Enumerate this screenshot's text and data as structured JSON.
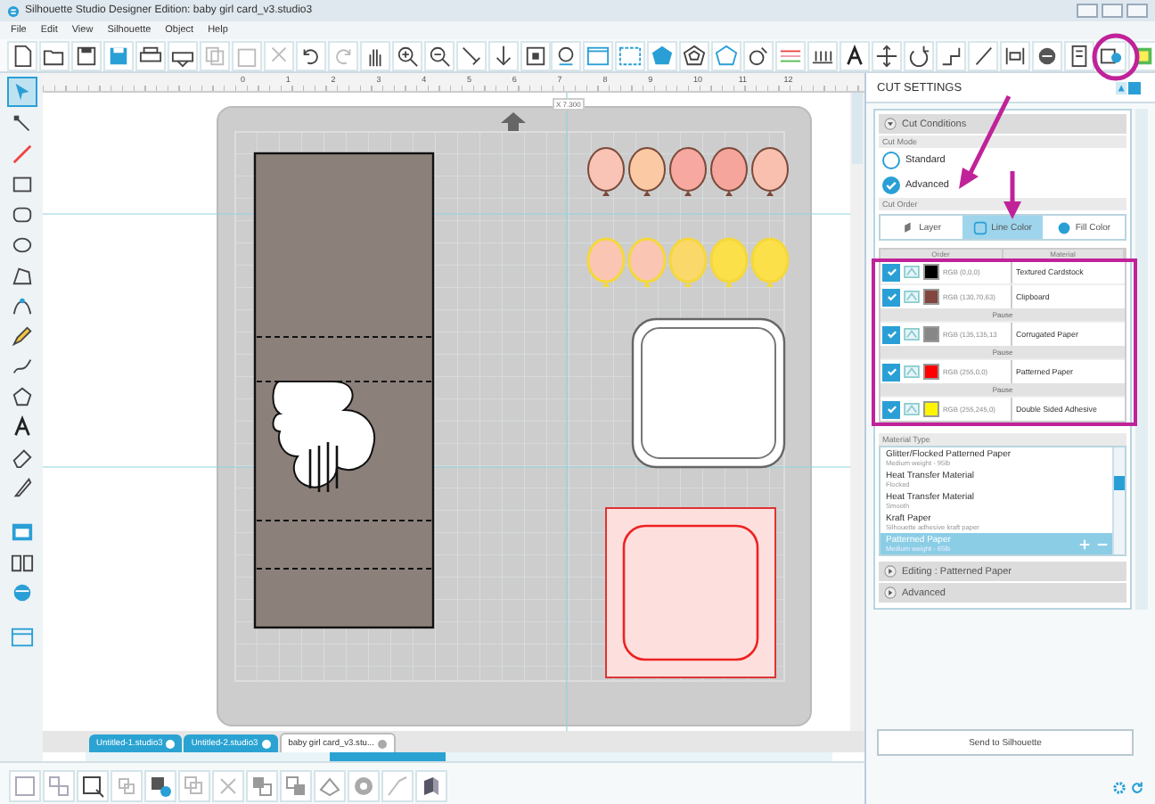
{
  "window": {
    "title": "Silhouette Studio Designer Edition: baby girl card_v3.studio3"
  },
  "menu": [
    "File",
    "Edit",
    "View",
    "Silhouette",
    "Object",
    "Help"
  ],
  "ruler": {
    "labels": [
      "0",
      "1",
      "2",
      "3",
      "4",
      "5",
      "6",
      "7",
      "8",
      "9",
      "10",
      "11",
      "12"
    ],
    "marker": "X 7.300"
  },
  "cut_settings": {
    "title": "CUT SETTINGS",
    "section": "Cut Conditions",
    "cut_mode": {
      "label": "Cut Mode",
      "options": [
        {
          "label": "Standard",
          "selected": false
        },
        {
          "label": "Advanced",
          "selected": true
        }
      ]
    },
    "cut_order": {
      "label": "Cut Order",
      "tabs": [
        {
          "label": "Layer",
          "selected": false
        },
        {
          "label": "Line Color",
          "selected": true
        },
        {
          "label": "Fill Color",
          "selected": false
        }
      ]
    },
    "table": {
      "columns": [
        "Order",
        "Material"
      ],
      "rows": [
        {
          "kind": "color",
          "checked": true,
          "color": "#000000",
          "rgb": "RGB (0,0,0)",
          "material": "Textured Cardstock"
        },
        {
          "kind": "color",
          "checked": true,
          "color": "#82463f",
          "rgb": "RGB (130,70,63)",
          "material": "Clipboard"
        },
        {
          "kind": "pause",
          "label": "Pause"
        },
        {
          "kind": "color",
          "checked": true,
          "color": "#878787",
          "rgb": "RGB (135,135,13",
          "material": "Corrugated Paper"
        },
        {
          "kind": "pause",
          "label": "Pause"
        },
        {
          "kind": "color",
          "checked": true,
          "color": "#ff0000",
          "rgb": "RGB (255,0,0)",
          "material": "Patterned Paper"
        },
        {
          "kind": "pause",
          "label": "Pause"
        },
        {
          "kind": "color",
          "checked": true,
          "color": "#fff500",
          "rgb": "RGB (255,245,0)",
          "material": "Double Sided Adhesive"
        }
      ]
    },
    "material_type": {
      "label": "Material Type",
      "items": [
        {
          "name": "Glitter/Flocked Patterned Paper",
          "detail": "Medium weight - 95lb",
          "selected": false
        },
        {
          "name": "Heat Transfer Material",
          "detail": "Flocked",
          "selected": false
        },
        {
          "name": "Heat Transfer Material",
          "detail": "Smooth",
          "selected": false
        },
        {
          "name": "Kraft Paper",
          "detail": "Silhouette adhesive kraft paper",
          "selected": false
        },
        {
          "name": "Patterned Paper",
          "detail": "Medium weight - 65lb",
          "selected": true
        }
      ]
    },
    "sections": [
      "Editing : Patterned Paper",
      "Advanced"
    ],
    "send_button": "Send to Silhouette"
  },
  "document_tabs": [
    {
      "label": "Untitled-1.studio3",
      "selected": false
    },
    {
      "label": "Untitled-2.studio3",
      "selected": false
    },
    {
      "label": "baby girl card_v3.stu...",
      "selected": true
    }
  ]
}
